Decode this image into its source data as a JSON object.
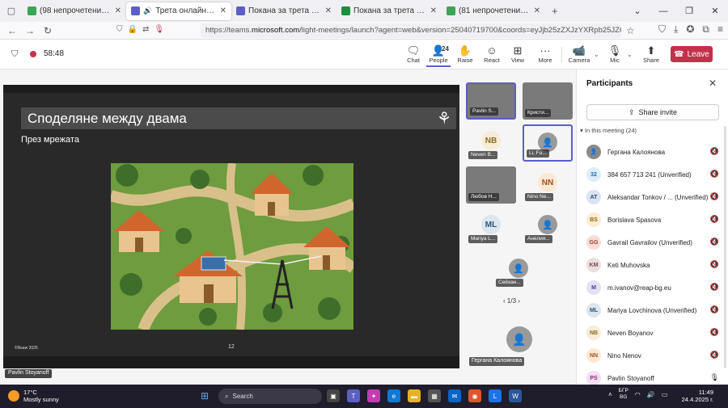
{
  "browser": {
    "tabs": [
      {
        "title": "(98 непрочетени) - АЕВ поща",
        "fav_color": "#3aa757"
      },
      {
        "title": "Трета онлайн информаци",
        "fav_color": "#5b5fc7",
        "active": true
      },
      {
        "title": "Покана за трета онлайн инфо",
        "fav_color": "#5b5fc7"
      },
      {
        "title": "Покана за трета онлайн инфо",
        "fav_color": "#1e8e3e"
      },
      {
        "title": "(81 непрочетени) - АЕВ поща",
        "fav_color": "#3aa757"
      }
    ],
    "new_tab": "+",
    "url_prefix": "https://teams.",
    "url_domain": "microsoft.com",
    "url_rest": "/light-meetings/launch?agent=web&version=25040719700&coords=eyJjb25zZXJzYXRpb25JZCI6IjE5Om1lZXRp"
  },
  "meeting": {
    "timer": "58:48",
    "buttons": {
      "chat": "Chat",
      "people": "People",
      "people_count": "24",
      "raise": "Raise",
      "react": "React",
      "view": "View",
      "more": "More",
      "camera": "Camera",
      "mic": "Mic",
      "share": "Share",
      "leave": "Leave"
    }
  },
  "slide": {
    "title": "Споделяне между двама",
    "subtitle": "През мрежата",
    "copyright": "©Nsaw 2025",
    "page": "12"
  },
  "presenter": "Pavlin Stoyanoff",
  "gallery": {
    "tiles": [
      {
        "label": "Pavlin S...",
        "kind": "video"
      },
      {
        "label": "Кристи...",
        "kind": "video"
      },
      {
        "label": "Neven B...",
        "initials": "NB",
        "bg": "#f6ecd8",
        "fg": "#8a6d1f"
      },
      {
        "label": "Li, Fu...",
        "kind": "anon",
        "selected": true
      },
      {
        "label": "Любов Н...",
        "kind": "video"
      },
      {
        "label": "Nino Ne...",
        "initials": "NN",
        "bg": "#fde9d3",
        "fg": "#a0531c"
      },
      {
        "label": "Mariya L...",
        "initials": "ML",
        "bg": "#dbe6ef",
        "fg": "#2f5476"
      },
      {
        "label": "Анелия...",
        "kind": "anon"
      },
      {
        "label": "Сейхан...",
        "kind": "anon"
      }
    ],
    "pager": "1/3",
    "big_tile_label": "Гергана Калоянова"
  },
  "participants": {
    "title": "Participants",
    "share_invite": "Share invite",
    "section": "In this meeting (24)",
    "items": [
      {
        "initials": "",
        "name": "Гергана Калоянова",
        "bg": "#8a8a8a",
        "fg": "#ffffff"
      },
      {
        "initials": "32",
        "name": "384 657 713 241 (Unverified)",
        "bg": "#dceefa",
        "fg": "#1a6fa8"
      },
      {
        "initials": "AT",
        "name": "Aleksandar Tonkov / ... (Unverified)",
        "bg": "#dbe3f3",
        "fg": "#2d4a8a"
      },
      {
        "initials": "BS",
        "name": "Borislava Spasova",
        "bg": "#fbecd2",
        "fg": "#9a6410"
      },
      {
        "initials": "GG",
        "name": "Gavrail Gavrailov (Unverified)",
        "bg": "#f9dcd7",
        "fg": "#a33a2c"
      },
      {
        "initials": "KM",
        "name": "Keti Muhovska",
        "bg": "#ecdede",
        "fg": "#7a4a4a"
      },
      {
        "initials": "M",
        "name": "m.ivanov@reap-bg.eu",
        "bg": "#e6e0f3",
        "fg": "#4f3a8a"
      },
      {
        "initials": "ML",
        "name": "Mariya Lovchinova (Unverified)",
        "bg": "#dbe6ef",
        "fg": "#2f5476"
      },
      {
        "initials": "NB",
        "name": "Neven Boyanov",
        "bg": "#f6ecd8",
        "fg": "#8a6d1f"
      },
      {
        "initials": "NN",
        "name": "Nino Nenov",
        "bg": "#fde9d3",
        "fg": "#a0531c"
      },
      {
        "initials": "PS",
        "name": "Pavlin Stoyanoff",
        "bg": "#f3dff0",
        "fg": "#8a2f7d",
        "mic_on": true
      }
    ]
  },
  "taskbar": {
    "temp": "17°C",
    "weather": "Mostly sunny",
    "search_placeholder": "Search",
    "lang_top": "БГР",
    "lang_bottom": "BG",
    "time": "11:49",
    "date": "24.4.2025 г."
  }
}
